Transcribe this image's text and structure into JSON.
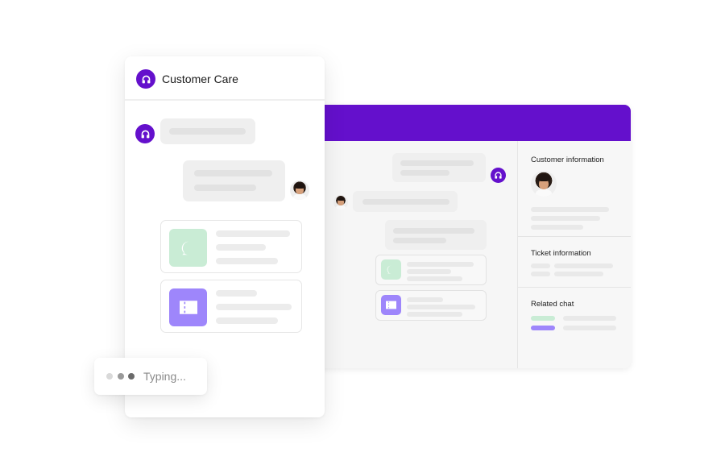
{
  "chat_window": {
    "title": "Customer Care",
    "header_icon": "headset-icon",
    "messages": [
      {
        "sender": "agent",
        "icon": "headset-icon",
        "type": "text-placeholder"
      },
      {
        "sender": "customer",
        "icon": "avatar",
        "type": "text-placeholder"
      }
    ],
    "cards": [
      {
        "icon": "chat-bubble-icon",
        "color": "#c9ecd5"
      },
      {
        "icon": "ticket-icon",
        "color": "#9e86fb"
      }
    ]
  },
  "typing_indicator": {
    "label": "Typing...",
    "dot_colors": [
      "#d9d9d9",
      "#9a9a9a",
      "#6a6a6a"
    ]
  },
  "dashboard": {
    "header_color": "#6410cc",
    "side_panel": {
      "sections": [
        {
          "title": "Customer information"
        },
        {
          "title": "Ticket information"
        },
        {
          "title": "Related chat",
          "tag_colors": [
            "#c9ecd5",
            "#9e86fb"
          ]
        }
      ]
    }
  },
  "colors": {
    "brand": "#6410cc",
    "green_tag": "#c9ecd5",
    "purple_tag": "#9e86fb"
  }
}
